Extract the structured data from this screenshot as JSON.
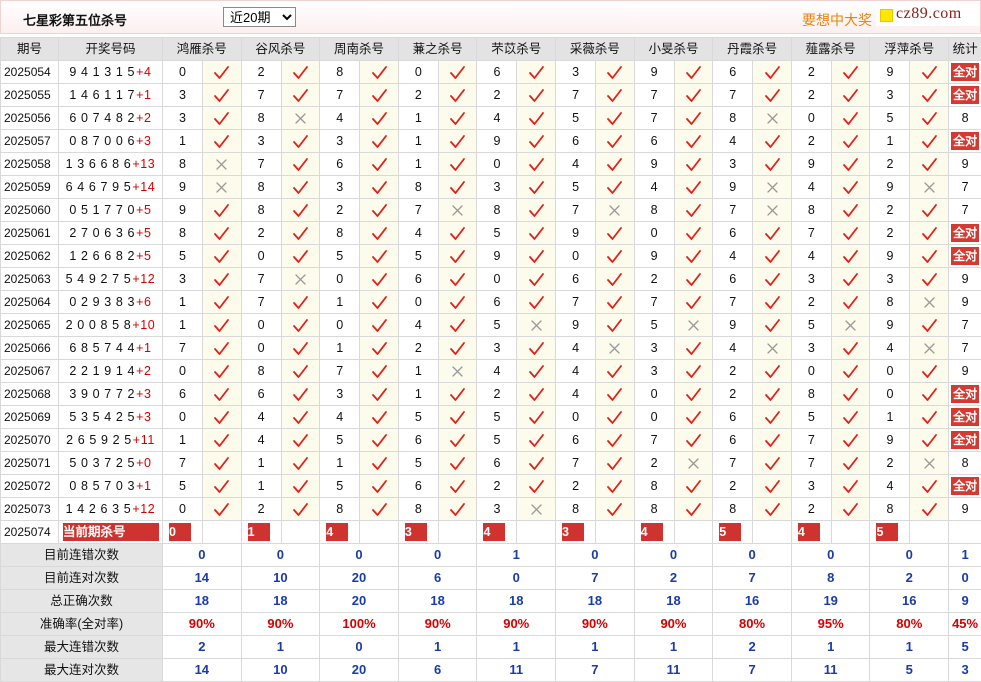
{
  "header": {
    "title": "七星彩第五位杀号",
    "period_select": {
      "selected": "近20期"
    },
    "promo_text": "要想中大奖",
    "logo_text": "cz89.com"
  },
  "icons": {
    "correct": "check-icon",
    "wrong": "cross-icon",
    "logo": "logo-square-icon"
  },
  "colors": {
    "check": "#e0201a",
    "cross": "#9a9a9a",
    "badge_red": "#d23a32",
    "stat_blue": "#1a3ca8",
    "stat_red": "#d40000",
    "promo_orange": "#e8850c"
  },
  "table": {
    "columns": [
      "期号",
      "开奖号码",
      "鸿雁杀号",
      "谷风杀号",
      "周南杀号",
      "蒹之杀号",
      "芣苡杀号",
      "采薇杀号",
      "小旻杀号",
      "丹霞杀号",
      "薤露杀号",
      "浮萍杀号",
      "统计"
    ],
    "rows": [
      {
        "issue": "2025054",
        "draw": "9 4 1 3 1 5",
        "special": "+4",
        "kills": [
          "0",
          "2",
          "8",
          "0",
          "6",
          "3",
          "9",
          "6",
          "2",
          "9"
        ],
        "correct": [
          true,
          true,
          true,
          true,
          true,
          true,
          true,
          true,
          true,
          true
        ],
        "stat": "全对"
      },
      {
        "issue": "2025055",
        "draw": "1 4 6 1 1 7",
        "special": "+1",
        "kills": [
          "3",
          "7",
          "7",
          "2",
          "2",
          "7",
          "7",
          "7",
          "2",
          "3"
        ],
        "correct": [
          true,
          true,
          true,
          true,
          true,
          true,
          true,
          true,
          true,
          true
        ],
        "stat": "全对"
      },
      {
        "issue": "2025056",
        "draw": "6 0 7 4 8 2",
        "special": "+2",
        "kills": [
          "3",
          "8",
          "4",
          "1",
          "4",
          "5",
          "7",
          "8",
          "0",
          "5"
        ],
        "correct": [
          true,
          false,
          true,
          true,
          true,
          true,
          true,
          false,
          true,
          true
        ],
        "stat": "8"
      },
      {
        "issue": "2025057",
        "draw": "0 8 7 0 0 6",
        "special": "+3",
        "kills": [
          "1",
          "3",
          "3",
          "1",
          "9",
          "6",
          "6",
          "4",
          "2",
          "1"
        ],
        "correct": [
          true,
          true,
          true,
          true,
          true,
          true,
          true,
          true,
          true,
          true
        ],
        "stat": "全对"
      },
      {
        "issue": "2025058",
        "draw": "1 3 6 6 8 6",
        "special": "+13",
        "kills": [
          "8",
          "7",
          "6",
          "1",
          "0",
          "4",
          "9",
          "3",
          "9",
          "2"
        ],
        "correct": [
          false,
          true,
          true,
          true,
          true,
          true,
          true,
          true,
          true,
          true
        ],
        "stat": "9"
      },
      {
        "issue": "2025059",
        "draw": "6 4 6 7 9 5",
        "special": "+14",
        "kills": [
          "9",
          "8",
          "3",
          "8",
          "3",
          "5",
          "4",
          "9",
          "4",
          "9"
        ],
        "correct": [
          false,
          true,
          true,
          true,
          true,
          true,
          true,
          false,
          true,
          false
        ],
        "stat": "7"
      },
      {
        "issue": "2025060",
        "draw": "0 5 1 7 7 0",
        "special": "+5",
        "kills": [
          "9",
          "8",
          "2",
          "7",
          "8",
          "7",
          "8",
          "7",
          "8",
          "2"
        ],
        "correct": [
          true,
          true,
          true,
          false,
          true,
          false,
          true,
          false,
          true,
          true
        ],
        "stat": "7"
      },
      {
        "issue": "2025061",
        "draw": "2 7 0 6 3 6",
        "special": "+5",
        "kills": [
          "8",
          "2",
          "8",
          "4",
          "5",
          "9",
          "0",
          "6",
          "7",
          "2"
        ],
        "correct": [
          true,
          true,
          true,
          true,
          true,
          true,
          true,
          true,
          true,
          true
        ],
        "stat": "全对"
      },
      {
        "issue": "2025062",
        "draw": "1 2 6 6 8 2",
        "special": "+5",
        "kills": [
          "5",
          "0",
          "5",
          "5",
          "9",
          "0",
          "9",
          "4",
          "4",
          "9"
        ],
        "correct": [
          true,
          true,
          true,
          true,
          true,
          true,
          true,
          true,
          true,
          true
        ],
        "stat": "全对"
      },
      {
        "issue": "2025063",
        "draw": "5 4 9 2 7 5",
        "special": "+12",
        "kills": [
          "3",
          "7",
          "0",
          "6",
          "0",
          "6",
          "2",
          "6",
          "3",
          "3"
        ],
        "correct": [
          true,
          false,
          true,
          true,
          true,
          true,
          true,
          true,
          true,
          true
        ],
        "stat": "9"
      },
      {
        "issue": "2025064",
        "draw": "0 2 9 3 8 3",
        "special": "+6",
        "kills": [
          "1",
          "7",
          "1",
          "0",
          "6",
          "7",
          "7",
          "7",
          "2",
          "8"
        ],
        "correct": [
          true,
          true,
          true,
          true,
          true,
          true,
          true,
          true,
          true,
          false
        ],
        "stat": "9"
      },
      {
        "issue": "2025065",
        "draw": "2 0 0 8 5 8",
        "special": "+10",
        "kills": [
          "1",
          "0",
          "0",
          "4",
          "5",
          "9",
          "5",
          "9",
          "5",
          "9"
        ],
        "correct": [
          true,
          true,
          true,
          true,
          false,
          true,
          false,
          true,
          false,
          true
        ],
        "stat": "7"
      },
      {
        "issue": "2025066",
        "draw": "6 8 5 7 4 4",
        "special": "+1",
        "kills": [
          "7",
          "0",
          "1",
          "2",
          "3",
          "4",
          "3",
          "4",
          "3",
          "4"
        ],
        "correct": [
          true,
          true,
          true,
          true,
          true,
          false,
          true,
          false,
          true,
          false
        ],
        "stat": "7"
      },
      {
        "issue": "2025067",
        "draw": "2 2 1 9 1 4",
        "special": "+2",
        "kills": [
          "0",
          "8",
          "7",
          "1",
          "4",
          "4",
          "3",
          "2",
          "0",
          "0"
        ],
        "correct": [
          true,
          true,
          true,
          false,
          true,
          true,
          true,
          true,
          true,
          true
        ],
        "stat": "9"
      },
      {
        "issue": "2025068",
        "draw": "3 9 0 7 7 2",
        "special": "+3",
        "kills": [
          "6",
          "6",
          "3",
          "1",
          "2",
          "4",
          "0",
          "2",
          "8",
          "0"
        ],
        "correct": [
          true,
          true,
          true,
          true,
          true,
          true,
          true,
          true,
          true,
          true
        ],
        "stat": "全对"
      },
      {
        "issue": "2025069",
        "draw": "5 3 5 4 2 5",
        "special": "+3",
        "kills": [
          "0",
          "4",
          "4",
          "5",
          "5",
          "0",
          "0",
          "6",
          "5",
          "1"
        ],
        "correct": [
          true,
          true,
          true,
          true,
          true,
          true,
          true,
          true,
          true,
          true
        ],
        "stat": "全对"
      },
      {
        "issue": "2025070",
        "draw": "2 6 5 9 2 5",
        "special": "+11",
        "kills": [
          "1",
          "4",
          "5",
          "6",
          "5",
          "6",
          "7",
          "6",
          "7",
          "9"
        ],
        "correct": [
          true,
          true,
          true,
          true,
          true,
          true,
          true,
          true,
          true,
          true
        ],
        "stat": "全对"
      },
      {
        "issue": "2025071",
        "draw": "5 0 3 7 2 5",
        "special": "+0",
        "kills": [
          "7",
          "1",
          "1",
          "5",
          "6",
          "7",
          "2",
          "7",
          "7",
          "2"
        ],
        "correct": [
          true,
          true,
          true,
          true,
          true,
          true,
          false,
          true,
          true,
          false
        ],
        "stat": "8"
      },
      {
        "issue": "2025072",
        "draw": "0 8 5 7 0 3",
        "special": "+1",
        "kills": [
          "5",
          "1",
          "5",
          "6",
          "2",
          "2",
          "8",
          "2",
          "3",
          "4"
        ],
        "correct": [
          true,
          true,
          true,
          true,
          true,
          true,
          true,
          true,
          true,
          true
        ],
        "stat": "全对"
      },
      {
        "issue": "2025073",
        "draw": "1 4 2 6 3 5",
        "special": "+12",
        "kills": [
          "0",
          "2",
          "8",
          "8",
          "3",
          "8",
          "8",
          "8",
          "2",
          "8"
        ],
        "correct": [
          true,
          true,
          true,
          true,
          false,
          true,
          true,
          true,
          true,
          true
        ],
        "stat": "9"
      }
    ],
    "current": {
      "issue": "2025074",
      "label": "当前期杀号",
      "kills": [
        "0",
        "1",
        "4",
        "3",
        "4",
        "3",
        "4",
        "5",
        "4",
        "5"
      ]
    },
    "stats": [
      {
        "label": "目前连错次数",
        "values": [
          "0",
          "0",
          "0",
          "0",
          "1",
          "0",
          "0",
          "0",
          "0",
          "0"
        ],
        "total": "1",
        "color": "#1a3ca8"
      },
      {
        "label": "目前连对次数",
        "values": [
          "14",
          "10",
          "20",
          "6",
          "0",
          "7",
          "2",
          "7",
          "8",
          "2"
        ],
        "total": "0",
        "color": "#1a3ca8"
      },
      {
        "label": "总正确次数",
        "values": [
          "18",
          "18",
          "20",
          "18",
          "18",
          "18",
          "18",
          "16",
          "19",
          "16"
        ],
        "total": "9",
        "color": "#1a3ca8"
      },
      {
        "label": "准确率(全对率)",
        "values": [
          "90%",
          "90%",
          "100%",
          "90%",
          "90%",
          "90%",
          "90%",
          "80%",
          "95%",
          "80%"
        ],
        "total": "45%",
        "color": "#d40000"
      },
      {
        "label": "最大连错次数",
        "values": [
          "2",
          "1",
          "0",
          "1",
          "1",
          "1",
          "1",
          "2",
          "1",
          "1"
        ],
        "total": "5",
        "color": "#1a3ca8"
      },
      {
        "label": "最大连对次数",
        "values": [
          "14",
          "10",
          "20",
          "6",
          "11",
          "7",
          "11",
          "7",
          "11",
          "5"
        ],
        "total": "3",
        "color": "#1a3ca8"
      }
    ]
  }
}
